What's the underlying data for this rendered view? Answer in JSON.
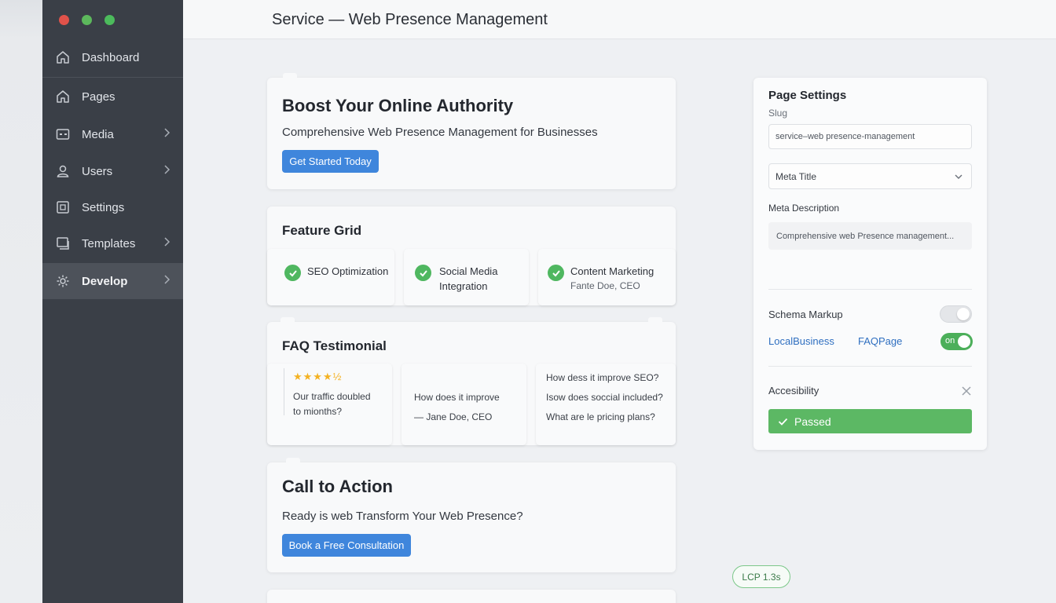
{
  "window": {
    "title": "Service — Web Presence Management",
    "traffic_colors": [
      "#e0524a",
      "#5cb85c",
      "#4cbb5c"
    ]
  },
  "sidebar": {
    "items": [
      {
        "label": "Dashboard",
        "icon": "home-icon",
        "chevron": false,
        "active": false
      },
      {
        "label": "Pages",
        "icon": "home-icon",
        "chevron": false,
        "active": false
      },
      {
        "label": "Media",
        "icon": "media-icon",
        "chevron": true,
        "active": false
      },
      {
        "label": "Users",
        "icon": "user-icon",
        "chevron": true,
        "active": false
      },
      {
        "label": "Settings",
        "icon": "settings-icon",
        "chevron": false,
        "active": false
      },
      {
        "label": "Templates",
        "icon": "templates-icon",
        "chevron": true,
        "active": false
      },
      {
        "label": "Develop",
        "icon": "gear-icon",
        "chevron": true,
        "active": true
      }
    ]
  },
  "hero": {
    "title": "Boost Your Online Authority",
    "subtitle": "Comprehensive Web Presence Management for Businesses",
    "button": "Get Started Today"
  },
  "features": {
    "title": "Feature Grid",
    "items": [
      {
        "line1": "SEO Optimization",
        "line2": "",
        "sub": ""
      },
      {
        "line1": "Social Media",
        "line2": "Integration",
        "sub": ""
      },
      {
        "line1": "Content Marketing",
        "line2": "",
        "sub": "Fante Doe, CEO"
      }
    ]
  },
  "faq": {
    "title": "FAQ Testimonial",
    "rating": "★★★★½",
    "testimonial_line1": "Our traffic doubled",
    "testimonial_line2": "to mionths?",
    "middle_line1": "How does it improve",
    "middle_line2": "— Jane Doe, CEO",
    "questions": [
      "How dess it improve SEO?",
      "Isow does soccial included?",
      "What are le pricing plans?"
    ]
  },
  "cta": {
    "title": "Call to Action",
    "text": "Ready is web Transform Your Web Presence?",
    "button": "Book a Free Consultation"
  },
  "settings": {
    "title": "Page Settings",
    "slug_label": "Slug",
    "slug_value": "service–web presence-management",
    "meta_title_select": "Meta Title",
    "meta_desc_label": "Meta Description",
    "meta_desc_value": "Comprehensive web Presence management...",
    "schema_label": "Schema Markup",
    "schema_toggle_on": false,
    "link_local": "LocalBusiness",
    "link_faq": "FAQPage",
    "faq_toggle_label": "on",
    "faq_toggle_on": true,
    "accessibility_label": "Accesibility",
    "passed_label": "Passed"
  },
  "lcp_badge": "LCP 1.3s",
  "colors": {
    "accent": "#3f86dc",
    "success": "#5cb864",
    "sidebar": "#3a3f47"
  }
}
